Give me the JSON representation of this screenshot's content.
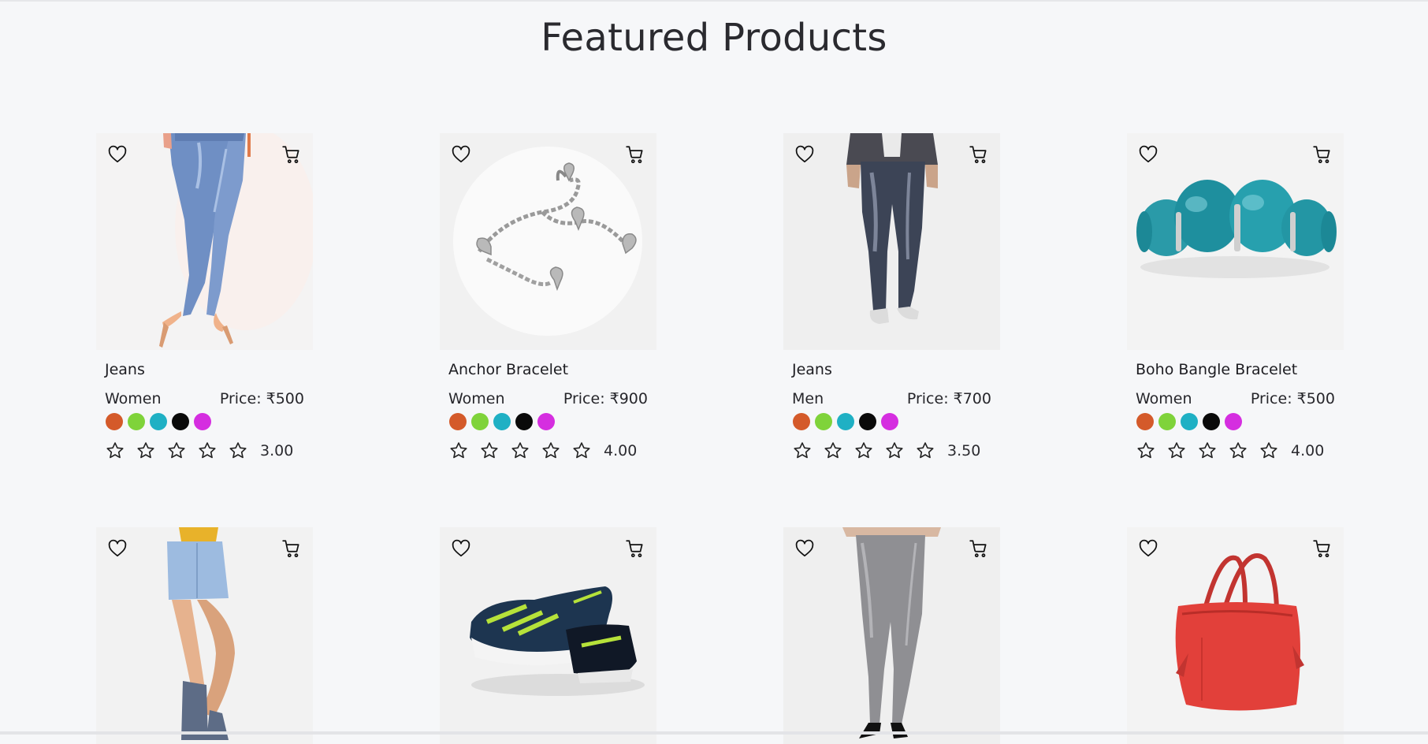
{
  "page": {
    "title": "Featured Products"
  },
  "colors": {
    "background": "#f6f7f9",
    "text": "#1f1f23"
  },
  "icons": {
    "wishlist": "heart-outline-icon",
    "cart": "shopping-cart-icon",
    "rating": "star-outline-icon"
  },
  "products": [
    {
      "name": "Jeans",
      "category": "Women",
      "price": "Price: ₹500",
      "rating": "3.00",
      "image": "womens-blue-jeans-legs",
      "swatches": [
        "#d45a2a",
        "#7fd33a",
        "#1fb0c4",
        "#0a0a0a",
        "#d52ee0"
      ]
    },
    {
      "name": "Anchor Bracelet",
      "category": "Women",
      "price": "Price: ₹900",
      "rating": "4.00",
      "image": "silver-heart-charm-bracelet",
      "swatches": [
        "#d45a2a",
        "#7fd33a",
        "#1fb0c4",
        "#0a0a0a",
        "#d52ee0"
      ]
    },
    {
      "name": "Jeans",
      "category": "Men",
      "price": "Price: ₹700",
      "rating": "3.50",
      "image": "mens-grey-jeans-legs",
      "swatches": [
        "#d45a2a",
        "#7fd33a",
        "#1fb0c4",
        "#0a0a0a",
        "#d52ee0"
      ]
    },
    {
      "name": "Boho Bangle Bracelet",
      "category": "Women",
      "price": "Price: ₹500",
      "rating": "4.00",
      "image": "turquoise-stone-bangle",
      "swatches": [
        "#d45a2a",
        "#7fd33a",
        "#1fb0c4",
        "#0a0a0a",
        "#d52ee0"
      ]
    },
    {
      "image": "denim-mini-skirt-legs"
    },
    {
      "image": "navy-green-running-shoes"
    },
    {
      "image": "grey-skinny-jeans-heels"
    },
    {
      "image": "red-leather-handbag"
    }
  ]
}
